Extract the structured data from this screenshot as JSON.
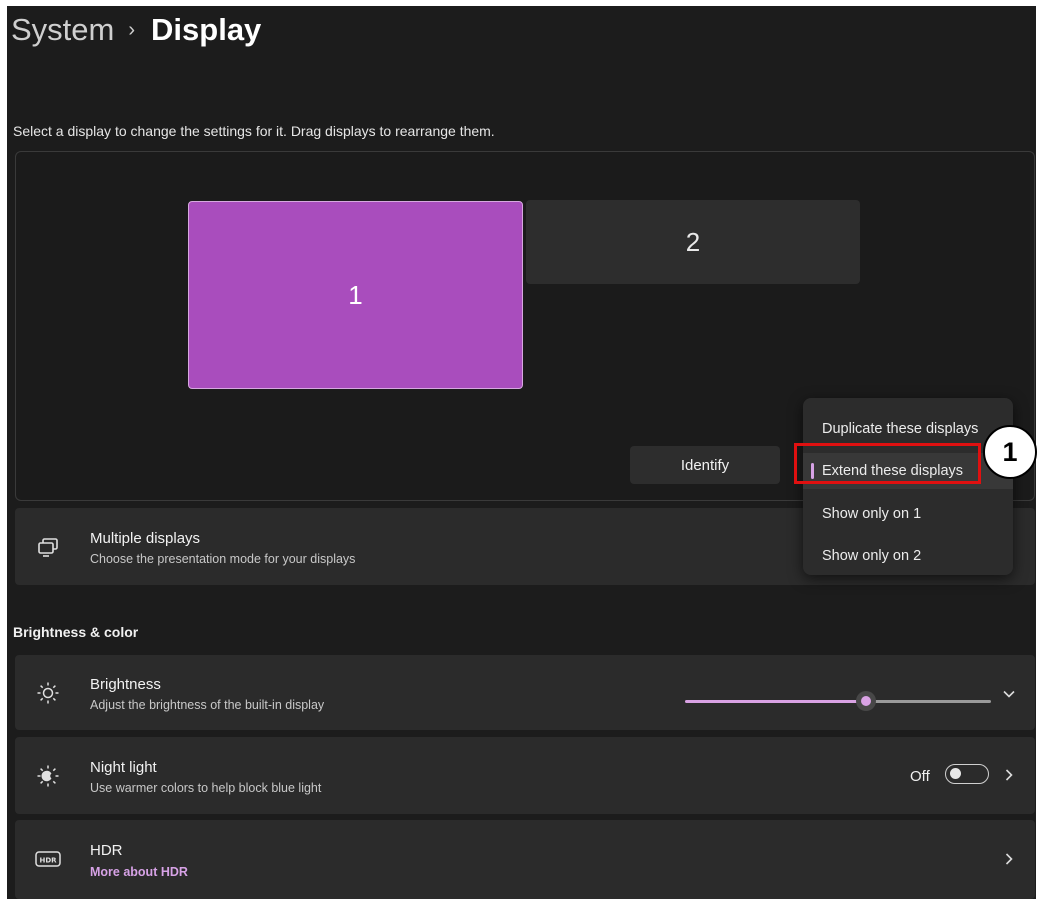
{
  "breadcrumb": {
    "parent": "System",
    "separator": "›",
    "current": "Display"
  },
  "instructions": "Select a display to change the settings for it. Drag displays to rearrange them.",
  "displays": [
    {
      "label": "1",
      "selected": true
    },
    {
      "label": "2",
      "selected": false
    }
  ],
  "identify_button": "Identify",
  "multiple_displays": {
    "title": "Multiple displays",
    "subtitle": "Choose the presentation mode for your displays"
  },
  "dropdown_menu": {
    "items": [
      {
        "label": "Duplicate these displays",
        "selected": false
      },
      {
        "label": "Extend these displays",
        "selected": true
      },
      {
        "label": "Show only on 1",
        "selected": false
      },
      {
        "label": "Show only on 2",
        "selected": false
      }
    ]
  },
  "section_title": "Brightness & color",
  "brightness": {
    "title": "Brightness",
    "subtitle": "Adjust the brightness of the built-in display",
    "value_percent": 59
  },
  "night_light": {
    "title": "Night light",
    "subtitle": "Use warmer colors to help block blue light",
    "state": "Off"
  },
  "hdr": {
    "title": "HDR",
    "link": "More about HDR",
    "icon_text": "HDR"
  },
  "annotation": {
    "number": "1"
  },
  "colors": {
    "accent": "#d7a2e6",
    "selected_display": "#a94dbd",
    "background": "#1c1c1c",
    "card": "#2b2b2b",
    "highlight": "#e01010"
  }
}
